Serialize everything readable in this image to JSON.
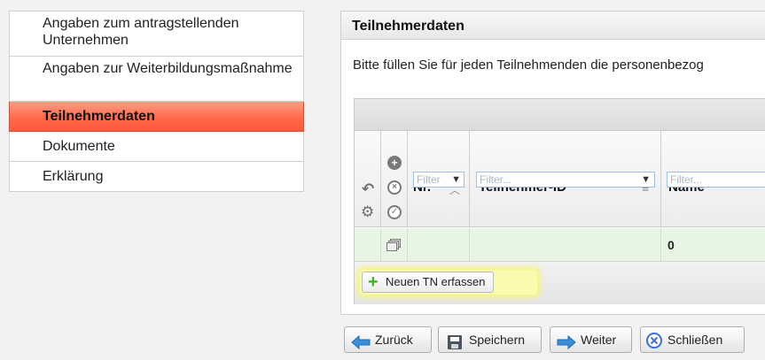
{
  "sidebar": {
    "items": [
      {
        "label": "Angaben zum antragstellenden Unternehmen"
      },
      {
        "label": "Angaben zur Weiterbildungsmaßnahme"
      },
      {
        "label": "Teilnehmerdaten",
        "active": true
      },
      {
        "label": "Dokumente"
      },
      {
        "label": "Erklärung"
      }
    ]
  },
  "panel": {
    "title": "Teilnehmerdaten",
    "intro": "Bitte füllen Sie für jeden Teilnehmenden die personenbezog"
  },
  "grid": {
    "columns": [
      {
        "label": "Nr.",
        "filter": "Filter"
      },
      {
        "label": "Teilnehmer-ID",
        "filter": "Filter..."
      },
      {
        "label": "Name",
        "filter": "Filter..."
      }
    ],
    "rows": [
      {
        "name": "0"
      }
    ],
    "add_button": "Neuen TN erfassen"
  },
  "footer": {
    "back": "Zurück",
    "save": "Speichern",
    "next": "Weiter",
    "close": "Schließen"
  },
  "colors": {
    "active_tab": "#ff6a4a",
    "row_highlight": "#e8f4e4",
    "button_highlight": "#f8f77a",
    "plus_green": "#3bb31b",
    "arrow_blue": "#3b8fd9"
  },
  "icons": [
    "undo-icon",
    "settings-icon",
    "plus-circle-icon",
    "clear-circle-icon",
    "check-circle-icon",
    "sort-asc-icon",
    "column-menu-icon",
    "filter-icon",
    "copy-icon",
    "plus-icon",
    "arrow-left-icon",
    "save-icon",
    "arrow-right-icon",
    "close-icon"
  ]
}
